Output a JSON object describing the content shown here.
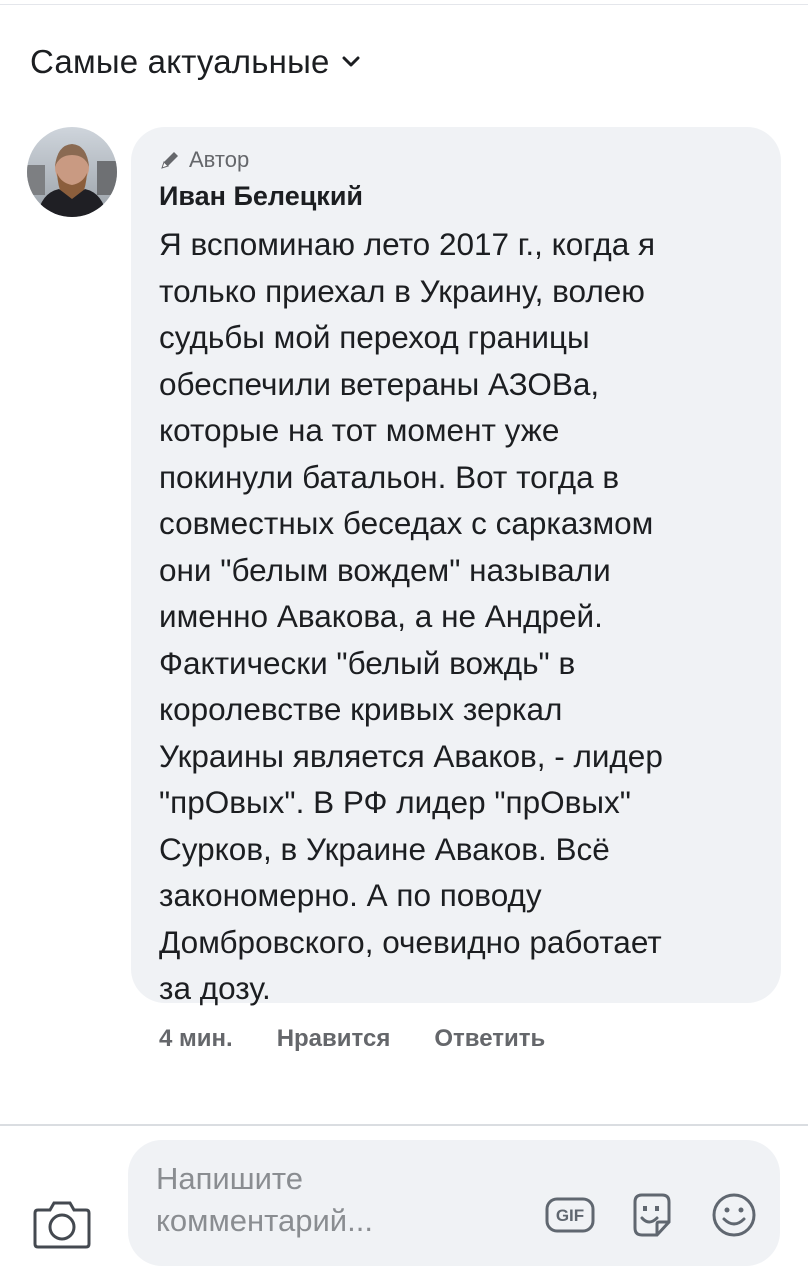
{
  "sort": {
    "label": "Самые актуальные",
    "icon": "chevron-down-icon"
  },
  "comment": {
    "badge_label": "Автор",
    "badge_icon": "pencil-icon",
    "author_name": "Иван Белецкий",
    "text": "Я вспоминаю лето 2017 г., когда я\nтолько приехал в Украину, волею\nсудьбы мой переход границы\nобеспечили ветераны АЗОВа,\nкоторые на тот момент уже\nпокинули батальон. Вот тогда в\nсовместных беседах с сарказмом\nони \"белым вождем\" называли\nименно Авакова, а не Андрей.\nФактически \"белый вождь\" в\nкоролевстве кривых зеркал\nУкраины является Аваков, - лидер\n\"прОвых\". В РФ лидер \"прОвых\"\nСурков, в Украине Аваков. Всё\nзакономерно. А по поводу\nДомбровского, очевидно работает\nза дозу.",
    "time": "4 мин.",
    "like_label": "Нравится",
    "reply_label": "Ответить"
  },
  "composer": {
    "placeholder": "Напишите комментарий...",
    "camera_icon": "camera-icon",
    "gif_label": "GIF",
    "sticker_icon": "sticker-icon",
    "emoji_icon": "emoji-icon"
  },
  "colors": {
    "bubble_bg": "#f0f2f5",
    "text_primary": "#1c1e21",
    "text_secondary": "#65676b",
    "placeholder": "#8a8d91"
  }
}
